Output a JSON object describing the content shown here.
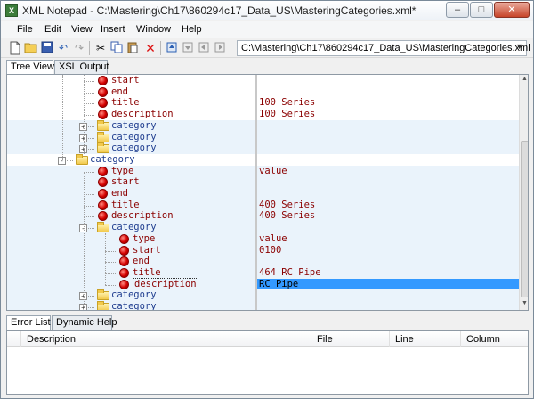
{
  "window": {
    "title": "XML Notepad - C:\\Mastering\\Ch17\\860294c17_Data_US\\MasteringCategories.xml*",
    "app_icon": "X",
    "controls": {
      "minimize": "–",
      "maximize": "□",
      "close": "✕"
    }
  },
  "menu": [
    "File",
    "Edit",
    "View",
    "Insert",
    "Window",
    "Help"
  ],
  "toolbar": {
    "icons": [
      "new-icon",
      "open-icon",
      "save-icon",
      "undo-icon",
      "redo-icon",
      "cut-icon",
      "copy-icon",
      "paste-icon",
      "delete-icon",
      "nudge-up-icon",
      "nudge-down-icon",
      "nudge-left-icon",
      "nudge-right-icon"
    ],
    "path": "C:\\Mastering\\Ch17\\860294c17_Data_US\\MasteringCategories.xml"
  },
  "tabs_top": [
    "Tree View",
    "XSL Output"
  ],
  "tree": [
    {
      "label": "start",
      "kind": "attr",
      "value": ""
    },
    {
      "label": "end",
      "kind": "attr",
      "value": ""
    },
    {
      "label": "title",
      "kind": "attr",
      "value": "100 Series"
    },
    {
      "label": "description",
      "kind": "attr",
      "value": "100 Series"
    },
    {
      "label": "category",
      "kind": "elem",
      "value": ""
    },
    {
      "label": "category",
      "kind": "elem",
      "value": ""
    },
    {
      "label": "category",
      "kind": "elem",
      "value": ""
    },
    {
      "label": "category",
      "kind": "elem",
      "value": ""
    },
    {
      "label": "type",
      "kind": "attr",
      "value": "value"
    },
    {
      "label": "start",
      "kind": "attr",
      "value": ""
    },
    {
      "label": "end",
      "kind": "attr",
      "value": ""
    },
    {
      "label": "title",
      "kind": "attr",
      "value": "400 Series"
    },
    {
      "label": "description",
      "kind": "attr",
      "value": "400 Series"
    },
    {
      "label": "category",
      "kind": "elem",
      "value": ""
    },
    {
      "label": "type",
      "kind": "attr",
      "value": "value"
    },
    {
      "label": "start",
      "kind": "attr",
      "value": "0100"
    },
    {
      "label": "end",
      "kind": "attr",
      "value": ""
    },
    {
      "label": "title",
      "kind": "attr",
      "value": "464 RC Pipe"
    },
    {
      "label": "description",
      "kind": "attr",
      "value": "RC Pipe"
    },
    {
      "label": "category",
      "kind": "elem",
      "value": ""
    },
    {
      "label": "category",
      "kind": "elem",
      "value": ""
    }
  ],
  "tabs_bottom": [
    "Error List",
    "Dynamic Help"
  ],
  "error_list": {
    "columns": [
      "Description",
      "File",
      "Line",
      "Column"
    ]
  },
  "colors": {
    "attribute": "#8b0000",
    "element": "#1f3d8f",
    "selection": "#3399ff",
    "row_band": "#eaf3fb"
  }
}
